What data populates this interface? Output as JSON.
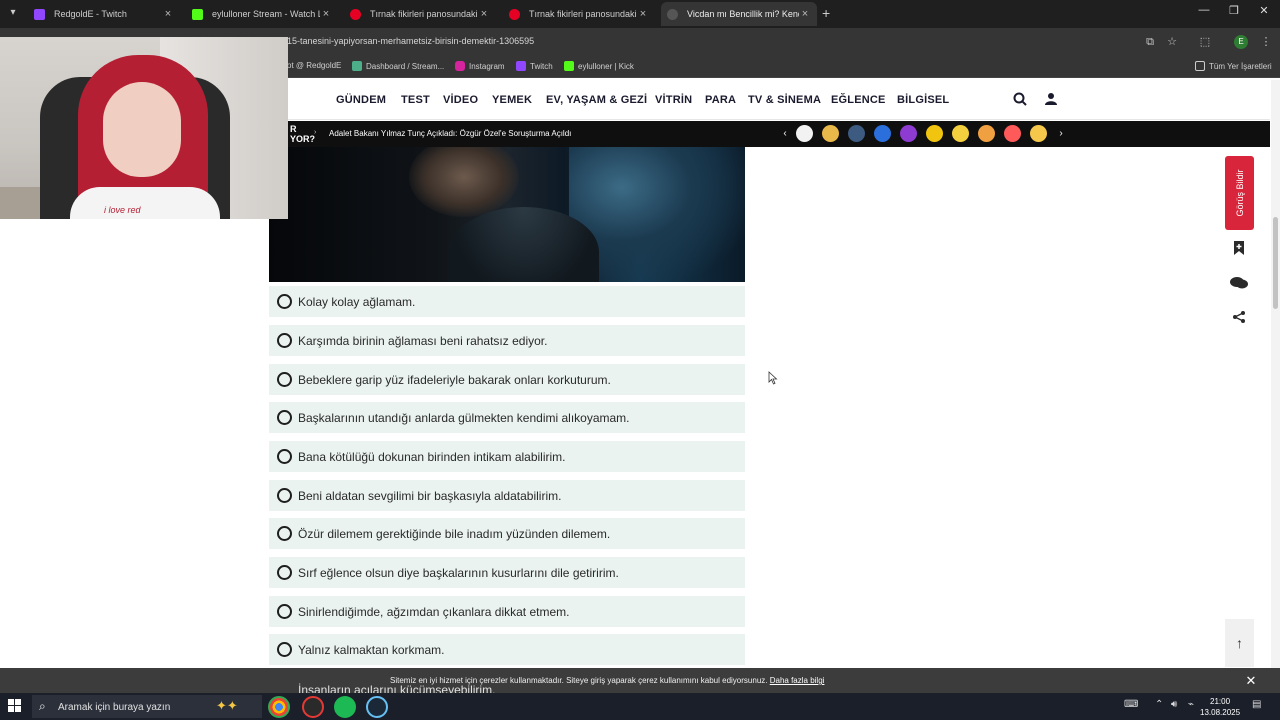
{
  "tabs": [
    {
      "label": "RedgoldE - Twitch",
      "icon": "twitch-icon",
      "color": "#9146ff"
    },
    {
      "label": "eylulloner Stream - Watch Live",
      "icon": "kick-icon",
      "color": "#53fc18"
    },
    {
      "label": "Tırnak fikirleri panosundaki Pin",
      "icon": "pinterest-icon",
      "color": "#e60023"
    },
    {
      "label": "Tırnak fikirleri panosundaki Pin",
      "icon": "pinterest-icon",
      "color": "#e60023"
    },
    {
      "label": "Vicdan mı Bencillik mi? Kendini",
      "icon": "site-icon",
      "color": "#444444"
    }
  ],
  "address": {
    "url": "15-tanesini-yapiyorsan-merhametsiz-birisin-demektir-1306595"
  },
  "bookmarks": [
    {
      "label": "ot @ RedgoldE",
      "color": "#888888"
    },
    {
      "label": "Dashboard / Stream...",
      "color": "#4caf8a"
    },
    {
      "label": "Instagram",
      "color": "#d6249f"
    },
    {
      "label": "Twitch",
      "color": "#9146ff"
    },
    {
      "label": "eylulloner | Kick",
      "color": "#53fc18"
    }
  ],
  "bookmarks_all": "Tüm Yer İşaretleri",
  "nav": {
    "items": [
      "GÜNDEM",
      "TEST",
      "VİDEO",
      "YEMEK",
      "EV, YAŞAM & GEZİ",
      "VİTRİN",
      "PARA",
      "TV & SİNEMA",
      "EĞLENCE",
      "BİLGİSEL"
    ]
  },
  "ticker": {
    "label_line1": "R",
    "label_line2": "YOR?",
    "headline": "Adalet Bakanı Yılmaz Tunç Açıkladı: Özgür Özel'e Soruşturma Açıldı",
    "emoji_colors": [
      "#f2f2f2",
      "#e8b84a",
      "#3d5a80",
      "#2a6fdb",
      "#8e3bd1",
      "#f1c40f",
      "#f4d03f",
      "#f0a040",
      "#ff5a5a",
      "#f5c84c"
    ]
  },
  "options": [
    "Kolay kolay ağlamam.",
    "Karşımda birinin ağlaması beni rahatsız ediyor.",
    "Bebeklere garip yüz ifadeleriyle bakarak onları korkuturum.",
    "Başkalarının utandığı anlarda gülmekten kendimi alıkoyamam.",
    "Bana kötülüğü dokunan birinden intikam alabilirim.",
    "Beni aldatan sevgilimi bir başkasıyla aldatabilirim.",
    "Özür dilemem gerektiğinde bile inadım yüzünden dilemem.",
    "Sırf eğlence olsun diye başkalarının kusurlarını dile getiririm.",
    "Sinirlendiğimde, ağzımdan çıkanlara dikkat etmem.",
    "Yalnız kalmaktan korkmam."
  ],
  "partial_option": "İnsanların acılarını küçümseyebilirim.",
  "feedback_label": "Görüş Bildir",
  "cookie": {
    "text": "Sitemiz en iyi hizmet için çerezler kullanmaktadır. Siteye giriş yaparak çerez kullanımını kabul ediyorsunuz.",
    "link": "Daha fazla bilgi"
  },
  "webcam": {
    "shirt_text": "i love red"
  },
  "taskbar": {
    "search_placeholder": "Aramak için buraya yazın",
    "time": "21:00",
    "date": "13.08.2025"
  },
  "colors": {
    "accent_red": "#d9253b",
    "option_bg": "#eaf3f0",
    "nav_text": "#1a1a2e"
  }
}
